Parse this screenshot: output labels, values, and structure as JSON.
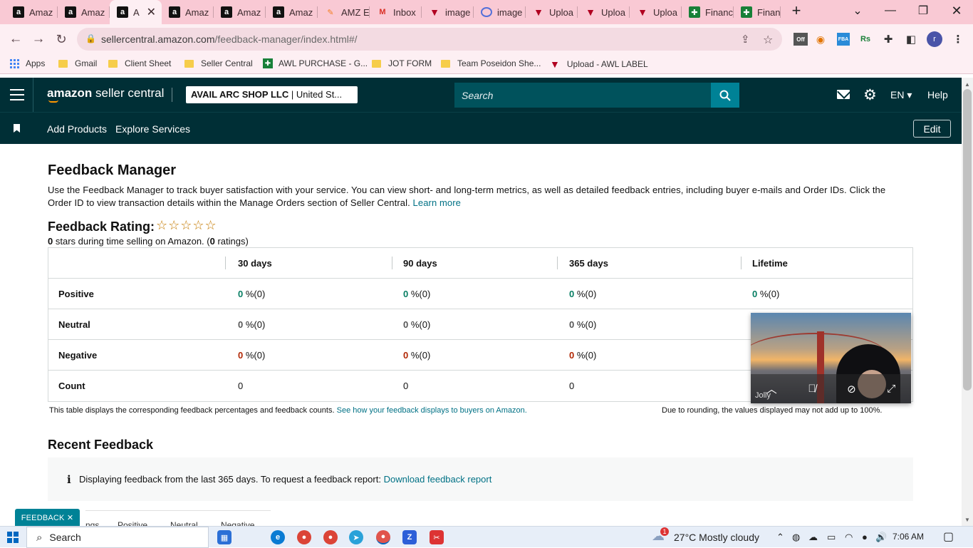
{
  "browser": {
    "tabs": [
      {
        "label": "Amaz",
        "icon": "amazon-favicon"
      },
      {
        "label": "Amaz",
        "icon": "amazon-favicon"
      },
      {
        "label": "A",
        "icon": "amazon-favicon",
        "active": true
      },
      {
        "label": "Amaz",
        "icon": "amazon-favicon"
      },
      {
        "label": "Amaz",
        "icon": "amazon-favicon"
      },
      {
        "label": "Amaz",
        "icon": "amazon-favicon"
      },
      {
        "label": "AMZ E",
        "icon": "amz-favicon"
      },
      {
        "label": "Inbox",
        "icon": "gmail-favicon"
      },
      {
        "label": "image",
        "icon": "upload-favicon"
      },
      {
        "label": "image",
        "icon": "image-favicon"
      },
      {
        "label": "Uploa",
        "icon": "upload-favicon"
      },
      {
        "label": "Uploa",
        "icon": "upload-favicon"
      },
      {
        "label": "Uploa",
        "icon": "upload-favicon"
      },
      {
        "label": "Financ",
        "icon": "sheets-favicon"
      },
      {
        "label": "Financ",
        "icon": "sheets-favicon"
      }
    ],
    "new_tab": "+",
    "url_host": "sellercentral.amazon.com",
    "url_path": "/feedback-manager/index.html#/",
    "extensions": {
      "off_badge": "Off",
      "fba": "FBA",
      "rs": "Rs"
    },
    "profile_initial": "r",
    "bookmarks": [
      {
        "label": "Apps",
        "type": "apps"
      },
      {
        "label": "Gmail",
        "type": "folder"
      },
      {
        "label": "Client Sheet",
        "type": "folder"
      },
      {
        "label": "Seller Central",
        "type": "folder"
      },
      {
        "label": "AWL PURCHASE - G...",
        "type": "sheet"
      },
      {
        "label": "JOT FORM",
        "type": "folder"
      },
      {
        "label": "Team Poseidon She...",
        "type": "folder"
      },
      {
        "label": "Upload - AWL LABEL",
        "type": "upload"
      }
    ]
  },
  "header": {
    "logo": "amazon seller central",
    "logo_brand": "amazon",
    "logo_rest": " seller central",
    "account": "AVAIL ARC SHOP LLC",
    "account_region": " | United St...",
    "search_placeholder": "Search",
    "language": "EN",
    "help": "Help"
  },
  "subnav": {
    "links": [
      "Add Products",
      "Explore Services"
    ],
    "edit": "Edit"
  },
  "page": {
    "title": "Feedback Manager",
    "description": "Use the Feedback Manager to track buyer satisfaction with your service. You can view short- and long-term metrics, as well as detailed feedback entries, including buyer e-mails and Order IDs. Click the Order ID to view transaction details within the Manage Orders section of Seller Central.",
    "learn_more": "Learn more",
    "rating_title": "Feedback Rating:",
    "stars": "☆☆☆☆☆",
    "rating_value": "0",
    "rating_text": " stars during time selling on Amazon. (",
    "rating_count": "0",
    "rating_count_text": " ratings)",
    "table": {
      "columns": [
        "30 days",
        "90 days",
        "365 days",
        "Lifetime"
      ],
      "rows": [
        {
          "label": "Positive",
          "kind": "pos",
          "cells": [
            "0",
            "0",
            "0",
            "0"
          ]
        },
        {
          "label": "Neutral",
          "kind": "neu",
          "cells": [
            "0",
            "0",
            "0"
          ]
        },
        {
          "label": "Negative",
          "kind": "neg",
          "cells": [
            "0",
            "0",
            "0"
          ]
        }
      ],
      "percent_suffix": " %(0)",
      "count_row": {
        "label": "Count",
        "cells": [
          "0",
          "0",
          "0"
        ]
      }
    },
    "table_note": "This table displays the corresponding feedback percentages and feedback counts.",
    "table_note_link": "See how your feedback displays to buyers on Amazon.",
    "rounding_note": "Due to rounding, the values displayed may not add up to 100%.",
    "recent_title": "Recent Feedback",
    "info_text": "Displaying feedback from the last 365 days. To request a feedback report:",
    "info_link": "Download feedback report",
    "sub_tabs": [
      "tings",
      "Positive",
      "Neutral",
      "Negative"
    ],
    "feedback_button": "FEEDBACK ✕"
  },
  "video": {
    "name": "Jolly"
  },
  "taskbar": {
    "search": "Search",
    "weather": "27°C  Mostly cloudy",
    "weather_badge": "1",
    "time": "7:06 AM"
  },
  "colors": {
    "accent": "#008296",
    "header_bg": "#002f36",
    "tab_bar": "#f9c9d4"
  }
}
